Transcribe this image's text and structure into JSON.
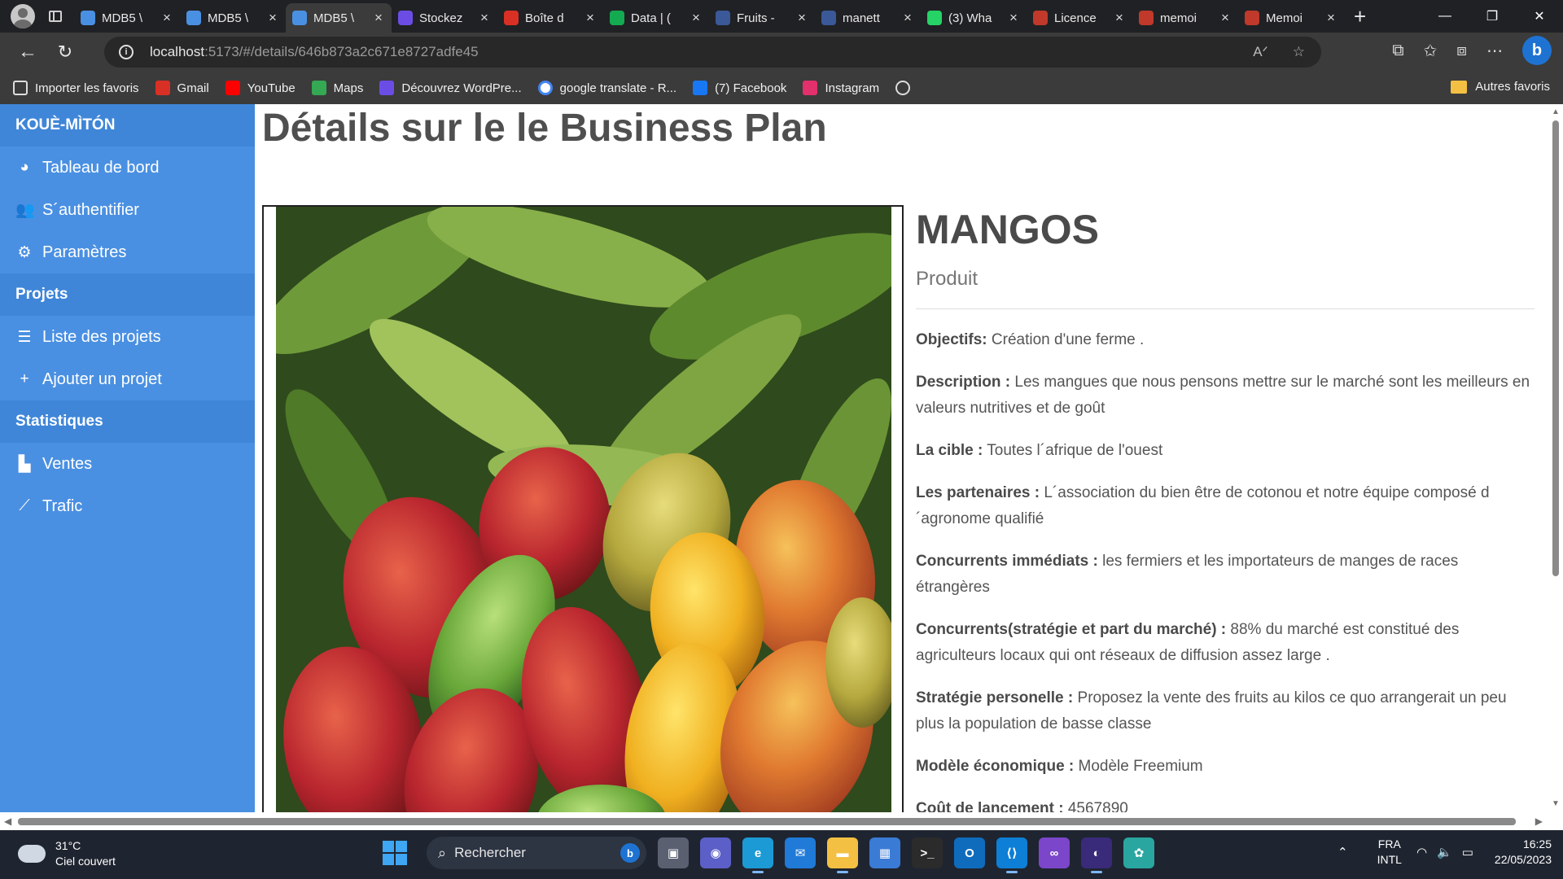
{
  "browser": {
    "tabs": [
      {
        "title": "MDB5 \\",
        "favicon": "mdb-icon",
        "color": "#4a90e2",
        "active": false
      },
      {
        "title": "MDB5 \\",
        "favicon": "mdb-icon",
        "color": "#4a90e2",
        "active": false
      },
      {
        "title": "MDB5 \\",
        "favicon": "mdb-icon",
        "color": "#4a90e2",
        "active": true
      },
      {
        "title": "Stockez",
        "favicon": "app-icon",
        "color": "#6b4de6",
        "active": false
      },
      {
        "title": "Boîte d",
        "favicon": "gmail-icon",
        "color": "#d93025",
        "active": false
      },
      {
        "title": "Data | (",
        "favicon": "leaf-icon",
        "color": "#13aa52",
        "active": false
      },
      {
        "title": "Fruits -",
        "favicon": "search-icon",
        "color": "#3b5998",
        "active": false
      },
      {
        "title": "manett",
        "favicon": "search-icon",
        "color": "#3b5998",
        "active": false
      },
      {
        "title": "(3) Wha",
        "favicon": "whatsapp-icon",
        "color": "#25d366",
        "active": false
      },
      {
        "title": "Licence",
        "favicon": "pdf-icon",
        "color": "#c0392b",
        "active": false
      },
      {
        "title": "memoi",
        "favicon": "pdf-icon",
        "color": "#c0392b",
        "active": false
      },
      {
        "title": "Memoi",
        "favicon": "pdf-icon",
        "color": "#c0392b",
        "active": false
      }
    ],
    "url_host": "localhost",
    "url_rest": ":5173/#/details/646b873a2c671e8727adfe45",
    "bookmarks": [
      {
        "label": "Importer les favoris",
        "icon": "import-icon",
        "color": "#3b3b3b"
      },
      {
        "label": "Gmail",
        "icon": "gmail-icon",
        "color": "#d93025"
      },
      {
        "label": "YouTube",
        "icon": "youtube-icon",
        "color": "#ff0000"
      },
      {
        "label": "Maps",
        "icon": "maps-icon",
        "color": "#34a853"
      },
      {
        "label": "Découvrez WordPre...",
        "icon": "app-icon",
        "color": "#6b4de6"
      },
      {
        "label": "google translate - R...",
        "icon": "google-icon",
        "color": "#ffffff"
      },
      {
        "label": "(7) Facebook",
        "icon": "facebook-icon",
        "color": "#1877f2"
      },
      {
        "label": "Instagram",
        "icon": "instagram-icon",
        "color": "#e1306c"
      },
      {
        "label": "",
        "icon": "github-icon",
        "color": "#3b3b3b"
      }
    ],
    "other_favorites": "Autres favoris"
  },
  "sidebar": {
    "brand": "KOUÈ-MÌTÓN",
    "items": [
      {
        "label": "Tableau de bord",
        "icon": "dashboard-icon",
        "glyph": "◕",
        "header": false
      },
      {
        "label": "S´authentifier",
        "icon": "users-icon",
        "glyph": "👥",
        "header": false
      },
      {
        "label": "Paramètres",
        "icon": "gear-icon",
        "glyph": "⚙",
        "header": false
      },
      {
        "label": "Projets",
        "icon": "",
        "glyph": "",
        "header": true
      },
      {
        "label": "Liste des projets",
        "icon": "list-icon",
        "glyph": "☰",
        "header": false
      },
      {
        "label": "Ajouter un projet",
        "icon": "plus-icon",
        "glyph": "+",
        "header": false
      },
      {
        "label": "Statistiques",
        "icon": "",
        "glyph": "",
        "header": true
      },
      {
        "label": "Ventes",
        "icon": "bar-chart-icon",
        "glyph": "▙",
        "header": false
      },
      {
        "label": "Trafic",
        "icon": "line-chart-icon",
        "glyph": "⟋",
        "header": false
      }
    ]
  },
  "page": {
    "title": "Détails sur le le Business Plan",
    "product_name": "MANGOS",
    "product_type": "Produit",
    "fields": [
      {
        "label": "Objectifs:",
        "value": "Création d'une ferme ."
      },
      {
        "label": "Description :",
        "value": "Les mangues que nous pensons mettre sur le marché sont les meilleurs en valeurs nutritives et de goût"
      },
      {
        "label": "La cible :",
        "value": "Toutes l´afrique de l'ouest"
      },
      {
        "label": "Les partenaires :",
        "value": "L´association du bien être de cotonou et notre équipe composé d ´agronome qualifié"
      },
      {
        "label": "Concurrents immédiats :",
        "value": "les fermiers et les importateurs de manges de races étrangères"
      },
      {
        "label": "Concurrents(stratégie et part du marché) :",
        "value": "88% du marché est constitué des agriculteurs locaux qui ont réseaux de diffusion assez large ."
      },
      {
        "label": "Stratégie personelle :",
        "value": "Proposez la vente des fruits au kilos ce quo arrangerait un peu plus la population de basse classe"
      },
      {
        "label": "Modèle économique :",
        "value": "Modèle Freemium"
      },
      {
        "label": "Coût de lancement :",
        "value": "4567890"
      }
    ]
  },
  "taskbar": {
    "temperature": "31°C",
    "weather": "Ciel couvert",
    "search_placeholder": "Rechercher",
    "lang_line1": "FRA",
    "lang_line2": "INTL",
    "time": "16:25",
    "date": "22/05/2023",
    "apps": [
      {
        "name": "task-view-icon",
        "color": "#5a6070",
        "glyph": "▣",
        "active": false
      },
      {
        "name": "meet-icon",
        "color": "#5b5fc7",
        "glyph": "◉",
        "active": false
      },
      {
        "name": "edge-icon",
        "color": "#1c9ad6",
        "glyph": "e",
        "active": true
      },
      {
        "name": "mail-icon",
        "color": "#1f7ad8",
        "glyph": "✉",
        "active": false
      },
      {
        "name": "explorer-icon",
        "color": "#f3c043",
        "glyph": "▬",
        "active": true
      },
      {
        "name": "store-icon",
        "color": "#3a7bd5",
        "glyph": "▦",
        "active": false
      },
      {
        "name": "terminal-icon",
        "color": "#2b2b2b",
        "glyph": ">_",
        "active": false
      },
      {
        "name": "outlook-icon",
        "color": "#0f6cbd",
        "glyph": "O",
        "active": false
      },
      {
        "name": "vscode-icon",
        "color": "#0e7fd6",
        "glyph": "⟨⟩",
        "active": true
      },
      {
        "name": "visual-studio-icon",
        "color": "#7b46c9",
        "glyph": "∞",
        "active": false
      },
      {
        "name": "eclipse-icon",
        "color": "#3a2a7a",
        "glyph": "◐",
        "active": true
      },
      {
        "name": "globe-app-icon",
        "color": "#2aa6a0",
        "glyph": "✿",
        "active": false
      }
    ]
  }
}
